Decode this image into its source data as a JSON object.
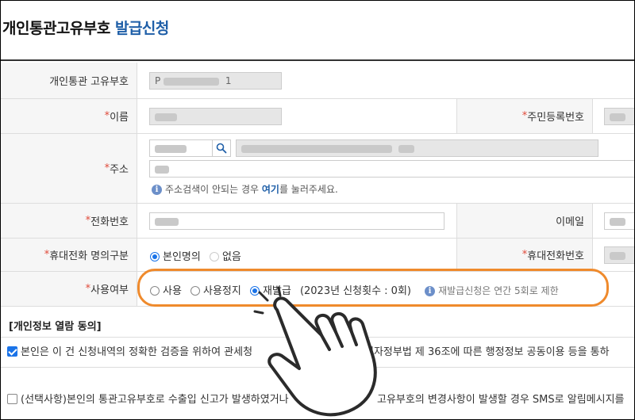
{
  "header": {
    "title_main": "개인통관고유부호",
    "title_accent": "발급신청"
  },
  "form": {
    "customs_code": {
      "label": "개인통관 고유부호",
      "value_prefix": "P",
      "value_suffix": "1"
    },
    "name": {
      "required_mark": "*",
      "label": "이름"
    },
    "resident_no": {
      "required_mark": "*",
      "label": "주민등록번호"
    },
    "address": {
      "required_mark": "*",
      "label": "주소",
      "note": "주소검색이 안되는 경우",
      "note_link": "여기",
      "note_tail": "를 눌러주세요."
    },
    "phone": {
      "required_mark": "*",
      "label": "전화번호"
    },
    "email": {
      "label": "이메일"
    },
    "mobile_owner": {
      "required_mark": "*",
      "label": "휴대전화 명의구분",
      "options": [
        "본인명의",
        "없음"
      ],
      "selected": "본인명의"
    },
    "mobile_no": {
      "required_mark": "*",
      "label": "휴대전화번호"
    },
    "usage": {
      "required_mark": "*",
      "label": "사용여부",
      "options": [
        "사용",
        "사용정지",
        "재발급"
      ],
      "selected": "재발급",
      "reissue_count": "(2023년 신청횟수 : 0회)",
      "info": "재발급신청은 연간 5회로 제한"
    }
  },
  "consent": {
    "title": "[개인정보 열람 동의]",
    "item1": {
      "checked": true,
      "text_left": "본인은 이 건 신청내역의 정확한 검증을 위하여 관세청",
      "text_right": "전자정부법 제 36조에 따른 행정정보 공동이용 등을 통하"
    },
    "item2": {
      "checked": false,
      "text_left": "(선택사항)본인의 통관고유부호로 수출입 신고가 발생하였거나",
      "text_right": "고유부호의 변경사항이 발생할 경우 SMS로 알림메시지를"
    }
  },
  "colors": {
    "accent": "#1f5fa8",
    "highlight": "#ef8a2c",
    "required": "#e04a3a",
    "radio": "#1a73e8"
  }
}
